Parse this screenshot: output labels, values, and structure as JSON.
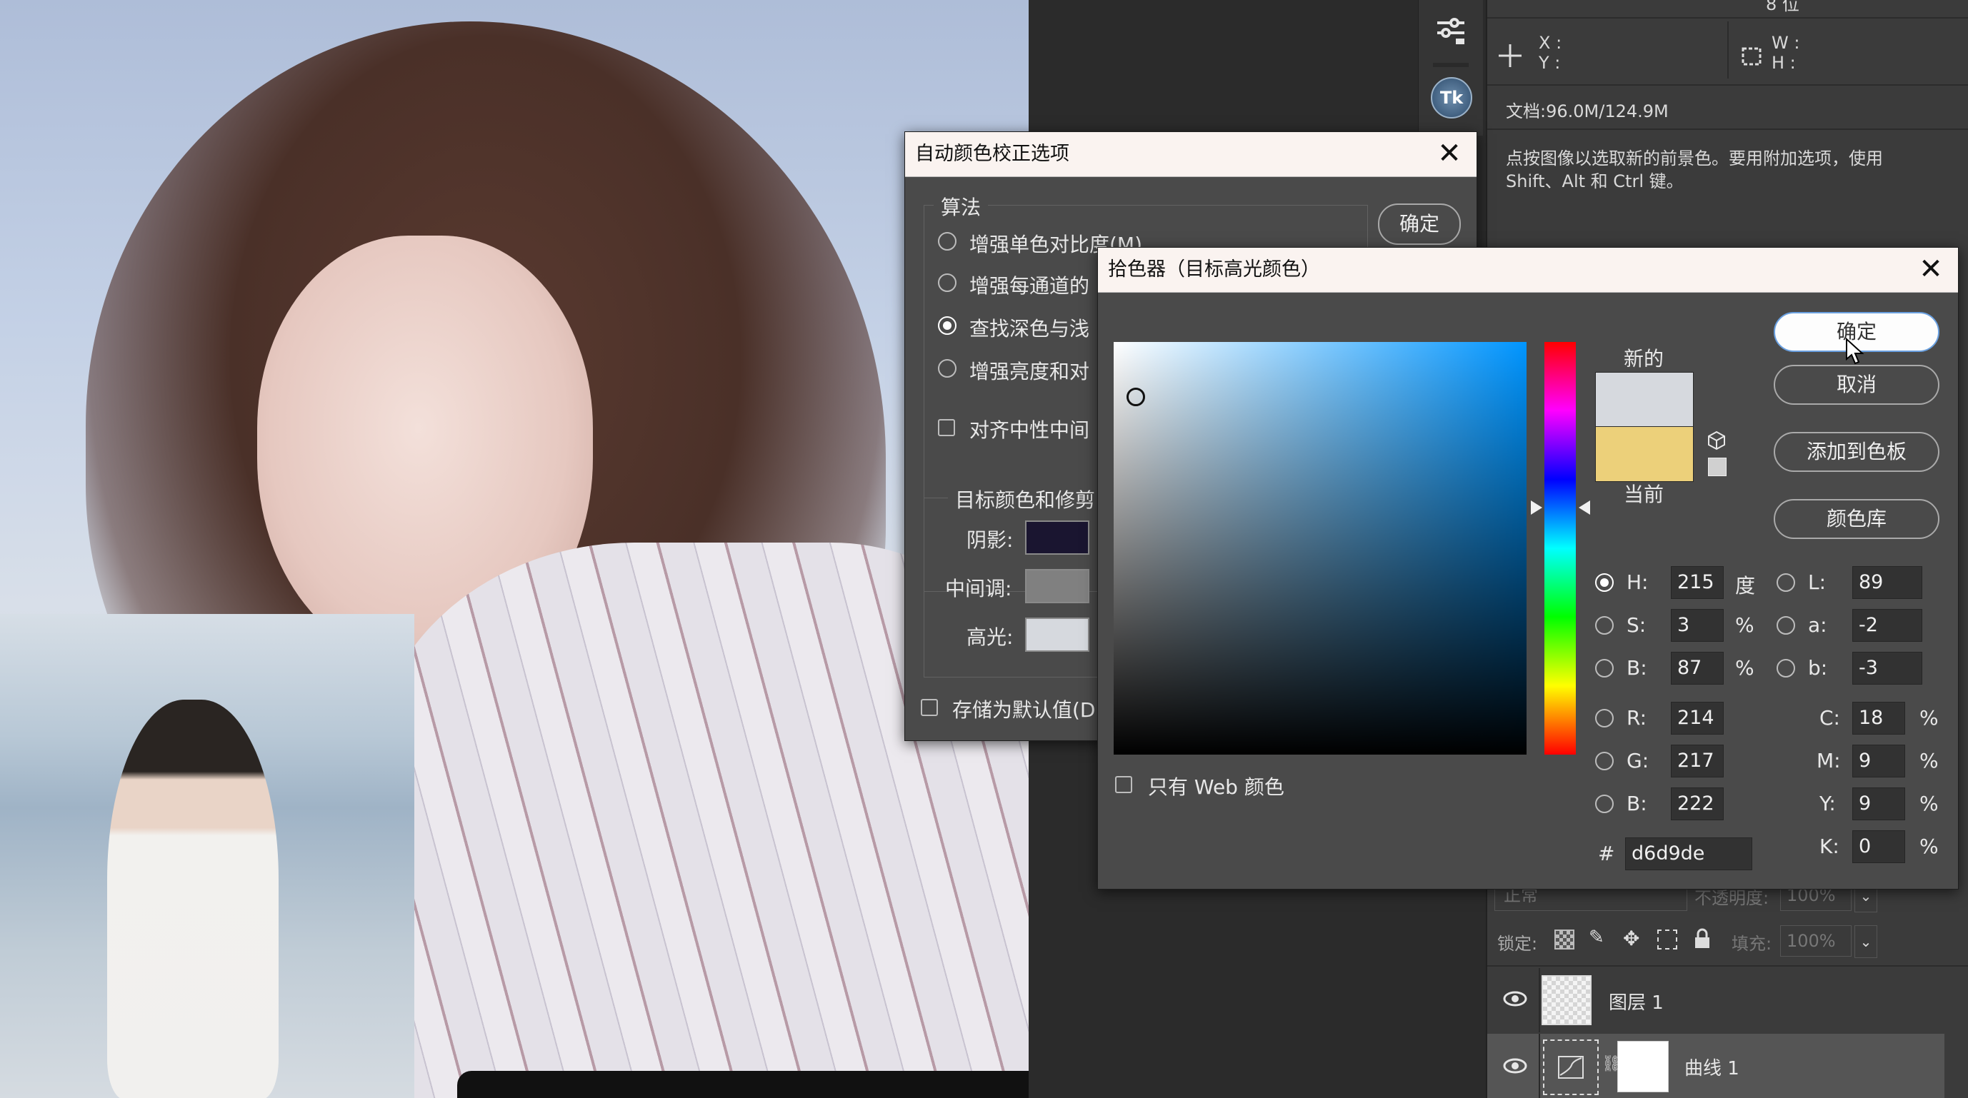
{
  "info_panel": {
    "x_label": "X :",
    "y_label": "Y :",
    "w_label": "W :",
    "h_label": "H :",
    "doc_size": "文档:96.0M/124.9M",
    "hint_line1": "点按图像以选取新的前景色。要用附加选项，使用",
    "hint_line2": "Shift、Alt 和 Ctrl 键。",
    "top_partial": "8 位"
  },
  "auto_color_dialog": {
    "title": "自动颜色校正选项",
    "ok_label": "确定",
    "algorithm_group": "算法",
    "options": [
      {
        "label": "增强单色对比度(M)",
        "selected": false
      },
      {
        "label": "增强每通道的",
        "selected": false
      },
      {
        "label": "查找深色与浅",
        "selected": true
      },
      {
        "label": "增强亮度和对",
        "selected": false
      }
    ],
    "snap_neutral_label": "对齐中性中间",
    "target_group": "目标颜色和修剪",
    "shadows_label": "阴影:",
    "midtones_label": "中间调:",
    "highlights_label": "高光:",
    "save_default_label": "存储为默认值(D",
    "colors": {
      "shadows": "#1a1530",
      "midtones": "#808080",
      "highlights": "#d6d9de"
    }
  },
  "color_picker": {
    "title": "拾色器（目标高光颜色）",
    "ok_label": "确定",
    "cancel_label": "取消",
    "add_swatch_label": "添加到色板",
    "libraries_label": "颜色库",
    "new_label": "新的",
    "current_label": "当前",
    "web_only_label": "只有 Web 颜色",
    "new_color": "#d6d9de",
    "current_color": "#ecd07a",
    "hue_base": "#0095ff",
    "fields": {
      "H": {
        "label": "H:",
        "value": "215",
        "unit": "度",
        "selected": true
      },
      "S": {
        "label": "S:",
        "value": "3",
        "unit": "%"
      },
      "B": {
        "label": "B:",
        "value": "87",
        "unit": "%"
      },
      "R": {
        "label": "R:",
        "value": "214"
      },
      "G": {
        "label": "G:",
        "value": "217"
      },
      "B2": {
        "label": "B:",
        "value": "222"
      },
      "L": {
        "label": "L:",
        "value": "89"
      },
      "a": {
        "label": "a:",
        "value": "-2"
      },
      "b": {
        "label": "b:",
        "value": "-3"
      },
      "C": {
        "label": "C:",
        "value": "18",
        "unit": "%"
      },
      "M": {
        "label": "M:",
        "value": "9",
        "unit": "%"
      },
      "Y": {
        "label": "Y:",
        "value": "9",
        "unit": "%"
      },
      "K": {
        "label": "K:",
        "value": "0",
        "unit": "%"
      }
    },
    "hex_label": "#",
    "hex_value": "d6d9de"
  },
  "layers_panel": {
    "blend_mode": "正常",
    "opacity_label": "不透明度:",
    "opacity_value": "100%",
    "lock_label": "锁定:",
    "fill_label": "填充:",
    "fill_value": "100%",
    "layers": [
      {
        "name": "图层 1",
        "visible": true
      },
      {
        "name": "曲线 1",
        "visible": true
      }
    ]
  },
  "tool_strip": {
    "logo_text": "Tk"
  }
}
